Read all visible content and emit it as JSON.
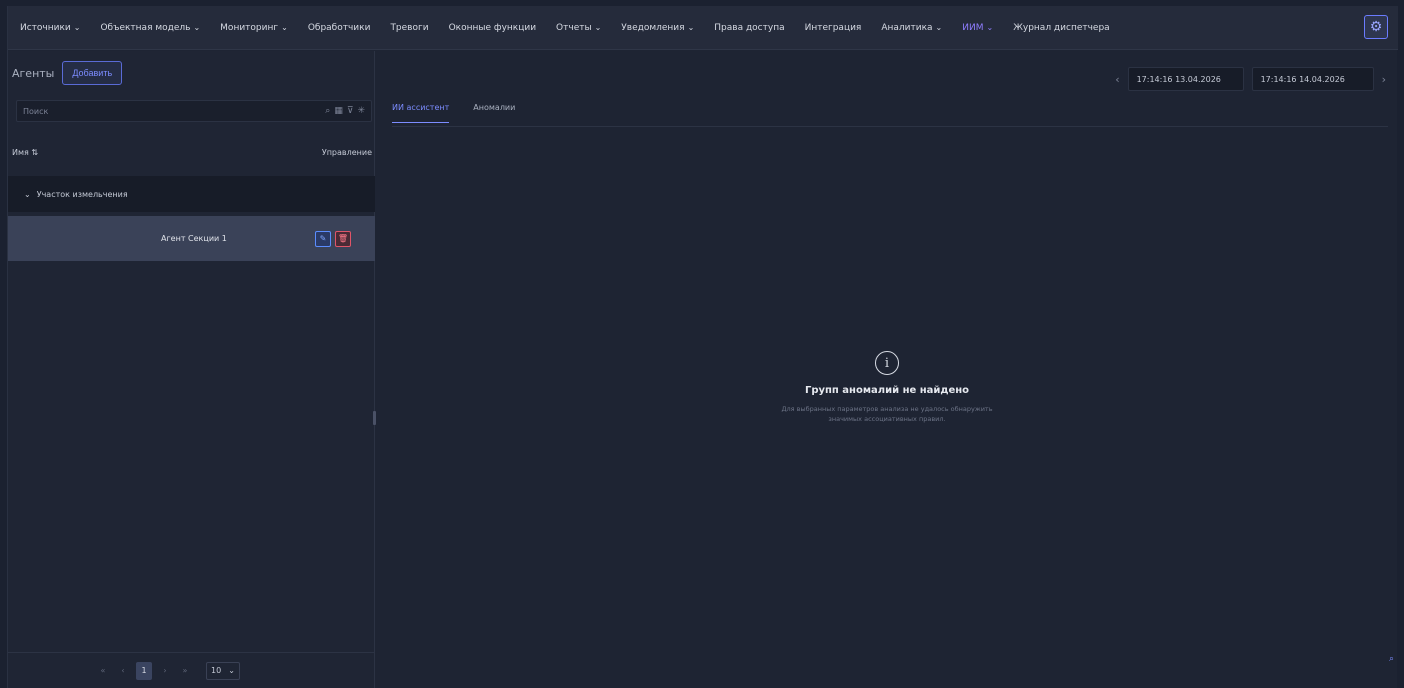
{
  "nav": {
    "items": [
      {
        "label": "Источники",
        "chevron": true
      },
      {
        "label": "Объектная модель",
        "chevron": true
      },
      {
        "label": "Мониторинг",
        "chevron": true
      },
      {
        "label": "Обработчики",
        "chevron": false
      },
      {
        "label": "Тревоги",
        "chevron": false
      },
      {
        "label": "Оконные функции",
        "chevron": false
      },
      {
        "label": "Отчеты",
        "chevron": true
      },
      {
        "label": "Уведомления",
        "chevron": true
      },
      {
        "label": "Права доступа",
        "chevron": false
      },
      {
        "label": "Интеграция",
        "chevron": false
      },
      {
        "label": "Аналитика",
        "chevron": true
      },
      {
        "label": "ИИМ",
        "chevron": true,
        "active": true
      },
      {
        "label": "Журнал диспетчера",
        "chevron": false
      }
    ],
    "settings_icon": "gear-icon"
  },
  "left": {
    "title": "Агенты",
    "add_label": "Добавить",
    "search_placeholder": "Поиск",
    "col_name": "Имя ⇅",
    "col_actions": "Управление",
    "group_label": "Участок измельчения",
    "agent_name": "Агент Секции 1",
    "pager": {
      "current": "1",
      "page_size": "10"
    }
  },
  "right": {
    "tabs": [
      "ИИ ассистент",
      "Аномалии"
    ],
    "date_from": "17:14:16 13.04.2026",
    "date_to": "17:14:16 14.04.2026",
    "empty_title": "Групп аномалий не найдено",
    "empty_desc": "Для выбранных параметров анализа не удалось обнаружить значимых ассоциативных правил."
  },
  "colors": {
    "accent": "#7c8cff",
    "bg": "#1e2433",
    "selected_row": "#3a4258",
    "delete": "#e05568"
  }
}
